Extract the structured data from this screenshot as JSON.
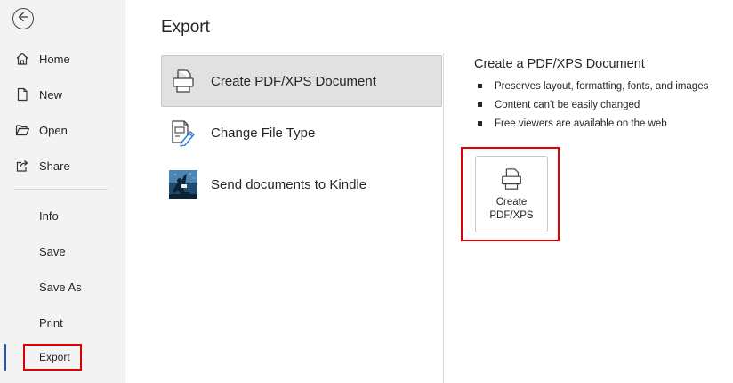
{
  "sidebar": {
    "items": [
      {
        "label": "Home",
        "icon": "home-icon"
      },
      {
        "label": "New",
        "icon": "new-document-icon"
      },
      {
        "label": "Open",
        "icon": "open-folder-icon"
      },
      {
        "label": "Share",
        "icon": "share-icon"
      },
      {
        "label": "Info"
      },
      {
        "label": "Save"
      },
      {
        "label": "Save As"
      },
      {
        "label": "Print"
      },
      {
        "label": "Export"
      }
    ],
    "active": "Export"
  },
  "main": {
    "title": "Export",
    "options": [
      {
        "label": "Create PDF/XPS Document",
        "icon": "pdf-document-icon",
        "selected": true
      },
      {
        "label": "Change File Type",
        "icon": "change-file-type-icon"
      },
      {
        "label": "Send documents to Kindle",
        "icon": "kindle-reader-icon"
      }
    ],
    "detail": {
      "title": "Create a PDF/XPS Document",
      "bullets": [
        "Preserves layout, formatting, fonts, and images",
        "Content can't be easily changed",
        "Free viewers are available on the web"
      ],
      "button_line1": "Create",
      "button_line2": "PDF/XPS"
    }
  },
  "colors": {
    "highlight": "#e00000",
    "accent": "#2b579a"
  }
}
